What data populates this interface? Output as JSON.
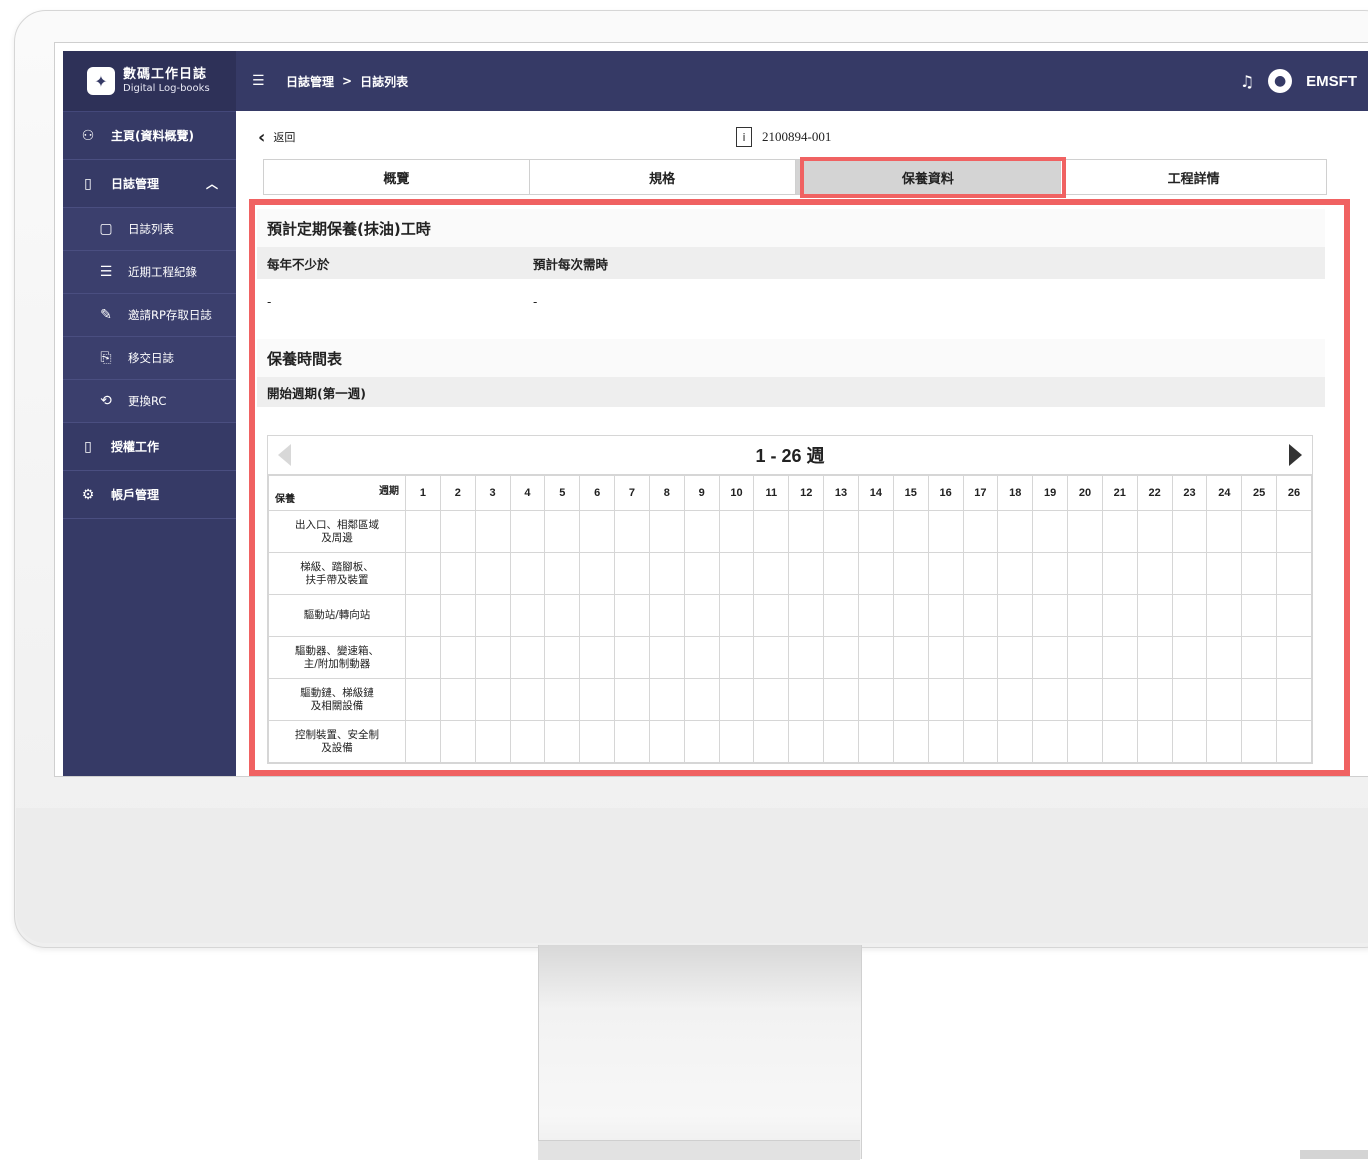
{
  "brand": {
    "title": "數碼工作日誌",
    "subtitle": "Digital Log-books"
  },
  "sidebar": {
    "items": [
      {
        "label": "主頁(資料概覽)",
        "icon": "dashboard-icon"
      },
      {
        "label": "日誌管理",
        "icon": "logbook-icon",
        "expanded": true
      },
      {
        "label": "授權工作",
        "icon": "authorization-icon"
      },
      {
        "label": "帳戶管理",
        "icon": "account-icon"
      }
    ],
    "subitems": [
      {
        "label": "日誌列表",
        "icon": "document-icon"
      },
      {
        "label": "近期工程紀錄",
        "icon": "list-icon"
      },
      {
        "label": "邀請RP存取日誌",
        "icon": "invite-icon"
      },
      {
        "label": "移交日誌",
        "icon": "handover-icon"
      },
      {
        "label": "更換RC",
        "icon": "exchange-icon"
      }
    ]
  },
  "header": {
    "breadcrumb": [
      "日誌管理",
      ">",
      "日誌列表"
    ],
    "user": "EMSFT"
  },
  "toolbar": {
    "back_label": "返回",
    "record_id": "2100894-001"
  },
  "tabs": [
    {
      "label": "概覽",
      "active": false
    },
    {
      "label": "規格",
      "active": false
    },
    {
      "label": "保養資料",
      "active": true
    },
    {
      "label": "工程詳情",
      "active": false
    }
  ],
  "maintenance": {
    "title": "預計定期保養(抹油)工時",
    "col1_label": "每年不少於",
    "col2_label": "預計每次需時",
    "col1_value": "-",
    "col2_value": "-"
  },
  "schedule": {
    "title": "保養時間表",
    "start_label": "開始週期(第一週)",
    "pager_label": "1 - 26 週",
    "corner_week": "週期",
    "corner_maint": "保養",
    "weeks": [
      "1",
      "2",
      "3",
      "4",
      "5",
      "6",
      "7",
      "8",
      "9",
      "10",
      "11",
      "12",
      "13",
      "14",
      "15",
      "16",
      "17",
      "18",
      "19",
      "20",
      "21",
      "22",
      "23",
      "24",
      "25",
      "26"
    ],
    "rows": [
      "出入口、相鄰區域\n及周邊",
      "梯級、踏腳板、\n扶手帶及裝置",
      "驅動站/轉向站",
      "驅動器、變速箱、\n主/附加制動器",
      "驅動鏈、梯級鏈\n及相關設備",
      "控制裝置、安全制\n及設備"
    ]
  },
  "colors": {
    "sidebar": "#363a66",
    "highlight": "#f06262",
    "active_tab": "#d4d4d4"
  }
}
